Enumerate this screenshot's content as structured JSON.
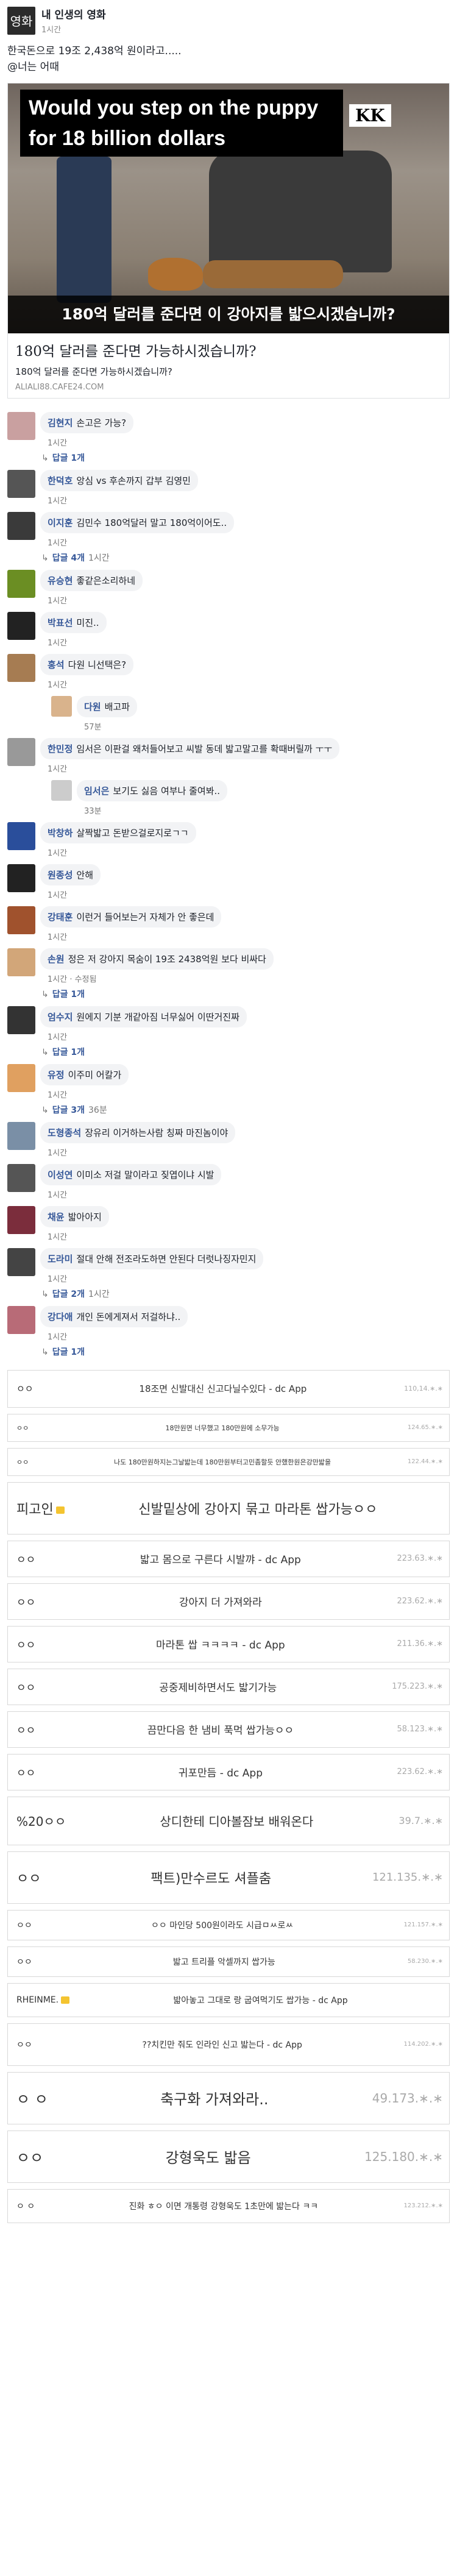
{
  "post": {
    "page_name": "내 인생의 영화",
    "avatar_text": "영화",
    "time": "1시간",
    "text_line1": "한국돈으로 19조 2,438억 원이라고.....",
    "text_line2": "@너는 어때",
    "hero_banner": "Would you step on the puppy for 18 billion dollars",
    "hero_logo": "KK",
    "hero_caption": "180억 달러를 준다면 이 강아지를 밟으시겠습니까?",
    "link_title": "180억 달러를 준다면 가능하시겠습니까?",
    "link_sub": "180억 달러를 준다면 가능하시겠습니까?",
    "link_domain": "ALIALI88.CAFE24.COM"
  },
  "comments": [
    {
      "name": "김현지",
      "text": "손고은 가능?",
      "time": "1시간",
      "reply": "답글 1개",
      "color": "#c9a0a0"
    },
    {
      "name": "한덕호",
      "text": "앙심 vs 후손까지 갑부 김영민",
      "time": "1시간",
      "color": "#555"
    },
    {
      "name": "이지훈",
      "text": "김민수 180억달러 말고 180억이어도..",
      "time": "1시간",
      "reply": "답글 4개",
      "reply_time": "1시간",
      "color": "#3a3a3a"
    },
    {
      "name": "유승현",
      "text": "좋같은소리하네",
      "time": "1시간",
      "color": "#6b8e23"
    },
    {
      "name": "박표선",
      "text": "미진..",
      "time": "1시간",
      "color": "#222"
    },
    {
      "name": "홍석",
      "text": "다원 니선택은?",
      "time": "1시간",
      "color": "#a67c52"
    },
    {
      "name": "다원",
      "text": "배고파",
      "time": "57분",
      "nested": true,
      "color": "#d9b38c"
    },
    {
      "name": "한민정",
      "text": "임서은 이판걸 왜처들어보고 씨발 동데 밟고말고를 확때버릴까 ㅜㅜ",
      "time": "1시간",
      "color": "#999"
    },
    {
      "name": "임서은",
      "text": "보기도 싫음 여부나 줄여봐..",
      "time": "33분",
      "nested": true,
      "color": "#ccc"
    },
    {
      "name": "박창하",
      "text": "살짝밟고 돈받으걸로지로ㄱㄱ",
      "time": "1시간",
      "color": "#2a4e9b"
    },
    {
      "name": "원종성",
      "text": "안해",
      "time": "1시간",
      "color": "#222"
    },
    {
      "name": "강태훈",
      "text": "이런거 들어보는거 자체가 안 좋은데",
      "time": "1시간",
      "color": "#a0522d"
    },
    {
      "name": "손원",
      "text": "정은 저 강아지 목숨이 19조 2438억원 보다 비싸다",
      "time": "1시간 · 수정됨",
      "reply": "답글 1개",
      "color": "#d2a679"
    },
    {
      "name": "엄수지",
      "text": "원에지 기분 개같아짐 너무싫어 이딴거진짜",
      "time": "1시간",
      "reply": "답글 1개",
      "color": "#333"
    },
    {
      "name": "유정",
      "text": "이주미 어칼가",
      "time": "1시간",
      "reply": "답글 3개",
      "reply_time": "36분",
      "color": "#e0a060"
    },
    {
      "name": "도형종석",
      "text": "장유리 이거하는사람 칭짜 마진놈이야",
      "time": "1시간",
      "color": "#7a8fa6"
    },
    {
      "name": "이성연",
      "text": "이미소 저걸 말이라고 짖엽이냐 시발",
      "time": "1시간",
      "color": "#555"
    },
    {
      "name": "채윤",
      "text": "밟아아지",
      "time": "1시간",
      "color": "#7b2d3c"
    },
    {
      "name": "도라미",
      "text": "절대 안해 전조라도하면 안된다 더럿나징자민지",
      "time": "1시간",
      "reply": "답글 2개",
      "reply_time": "1시간",
      "color": "#444"
    },
    {
      "name": "강다애",
      "text": "개인 돈에게져서 저걸하냐..",
      "time": "1시간",
      "reply": "답글 1개",
      "color": "#b86b77"
    }
  ],
  "dc_rows": [
    {
      "nick": "ㅇㅇ",
      "body": "18조면 신발대신 신고다닐수있다 - dc App",
      "ip": "110,14.∗.∗",
      "h": 62,
      "fs": 15
    },
    {
      "nick": "ㅇㅇ",
      "body": "18만원면 너무했고 180만원에 소무가능",
      "ip": "124.65.∗.∗",
      "h": 46,
      "fs": 11
    },
    {
      "nick": "ㅇㅇ",
      "body": "나도 180만원하지는그날밟는데 180만원부터고민좀할듯 안했한원은강만밟을",
      "ip": "122.44.∗.∗",
      "h": 46,
      "fs": 11
    },
    {
      "nick": "피고인",
      "body": "신발밑상에 강아지 묶고 마라톤 쌉가능ㅇㅇ",
      "ip": "",
      "h": 86,
      "fs": 22,
      "icon": true
    },
    {
      "nick": "ㅇㅇ",
      "body": "밟고 몸으로 구른다 시발꺄 - dc App",
      "ip": "223.63.∗.∗",
      "h": 60,
      "fs": 17
    },
    {
      "nick": "ㅇㅇ",
      "body": "강아지 더 가져와라",
      "ip": "223.62.∗.∗",
      "h": 60,
      "fs": 17
    },
    {
      "nick": "ㅇㅇ",
      "body": "마라톤 쌉 ㅋㅋㅋㅋ - dc App",
      "ip": "211.36.∗.∗",
      "h": 60,
      "fs": 17
    },
    {
      "nick": "ㅇㅇ",
      "body": "공중제비하면서도 밟기가능",
      "ip": "175.223.∗.∗",
      "h": 60,
      "fs": 17
    },
    {
      "nick": "ㅇㅇ",
      "body": "끔만다음 한 냄비 푹먹 쌉가능ㅇㅇ",
      "ip": "58.123.∗.∗",
      "h": 60,
      "fs": 17
    },
    {
      "nick": "ㅇㅇ",
      "body": "귀포만듬 - dc App",
      "ip": "223.62.∗.∗",
      "h": 60,
      "fs": 17
    },
    {
      "nick": "%20ㅇㅇ",
      "body": "상디한테 디아볼잠보 배워온다",
      "ip": "39.7.∗.∗",
      "h": 80,
      "fs": 20
    },
    {
      "nick": "ㅇㅇ",
      "body": "팩트)만수르도 셔플춤",
      "ip": "121.135.∗.∗",
      "h": 86,
      "fs": 22
    },
    {
      "nick": "ㅇㅇ",
      "body": "ㅇㅇ 마인당 500원이라도 시급ㅁㅆ로ㅆ",
      "ip": "121.157.∗.∗",
      "h": 50,
      "fs": 14
    },
    {
      "nick": "ㅇㅇ",
      "body": "밟고 트리플 악셀까지 쌉가능",
      "ip": "58.230.∗.∗",
      "h": 50,
      "fs": 14
    },
    {
      "nick": "RHEINME.",
      "body": "밟아놓고 그대로 랑 굽여먹기도 쌉가능 - dc App",
      "ip": "",
      "h": 56,
      "fs": 14,
      "icon": true
    },
    {
      "nick": "ㅇㅇ",
      "body": "??치킨만 줘도 인라인 신고 밟는다 - dc App",
      "ip": "114.202.∗.∗",
      "h": 70,
      "fs": 14
    },
    {
      "nick": "ㅇ ㅇ",
      "body": "축구화 가져와라..",
      "ip": "49.173.∗.∗",
      "h": 86,
      "fs": 24
    },
    {
      "nick": "ㅇㅇ",
      "body": "강형욱도 밟음",
      "ip": "125.180.∗.∗",
      "h": 86,
      "fs": 24
    },
    {
      "nick": "ㅇ ㅇ",
      "body": "진화 ㅎㅇ 이면 개통령 강형욱도 1초만에 밟는다 ㅋㅋ",
      "ip": "123.212.∗.∗",
      "h": 56,
      "fs": 14
    }
  ]
}
